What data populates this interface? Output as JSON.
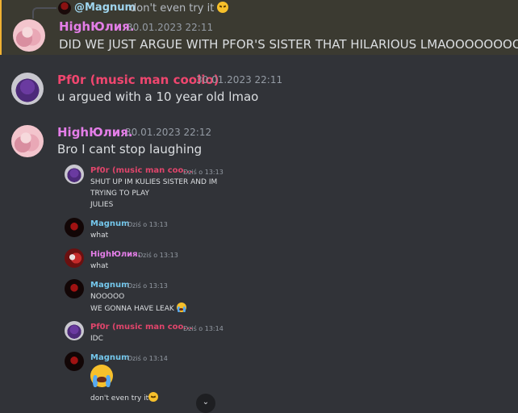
{
  "messages": {
    "m1": {
      "reply_author": "@Magnum",
      "reply_text": "don't even try it",
      "author": "HighЮлия.",
      "time": "30.01.2023 22:11",
      "text": "DID WE JUST ARGUE WITH PFOR'S SISTER THAT HILARIOUS LMAOOOOOOOOO"
    },
    "m2": {
      "author": "Pf0r (music man coolio)",
      "time": "30.01.2023 22:11",
      "text": "u argued with a 10 year old lmao"
    },
    "m3": {
      "author": "HighЮлия.",
      "time": "30.01.2023 22:12",
      "text": "Bro I cant stop laughing"
    }
  },
  "screenshot": {
    "s1": {
      "author": "Pf0r (music man coo...",
      "time": "Dziś o 13:13",
      "lines": [
        "SHUT UP IM KULIES SISTER AND IM",
        "TRYING TO PLAY",
        "JULIES"
      ]
    },
    "s2": {
      "author": "Magnum",
      "time": "Dziś o 13:13",
      "text": "what"
    },
    "s3": {
      "author": "HighЮлия.",
      "time": "Dziś o 13:13",
      "text": "what"
    },
    "s4": {
      "author": "Magnum",
      "time": "Dziś o 13:13",
      "lines": [
        "NOOOOO",
        "WE GONNA HAVE LEAK"
      ]
    },
    "s5": {
      "author": "Pf0r (music man coo...",
      "time": "Dziś o 13:14",
      "text": "IDC"
    },
    "s6": {
      "author": "Magnum",
      "time": "Dziś o 13:14",
      "text": "don't even try it"
    }
  },
  "icons": {
    "angry": "angry-face-emoji",
    "cry": "loudly-crying-face-emoji",
    "scroll": "chevron-down-icon"
  },
  "colors": {
    "background": "#313338",
    "mention_highlight": "#3b3a31",
    "mention_bar": "#f0b132"
  }
}
